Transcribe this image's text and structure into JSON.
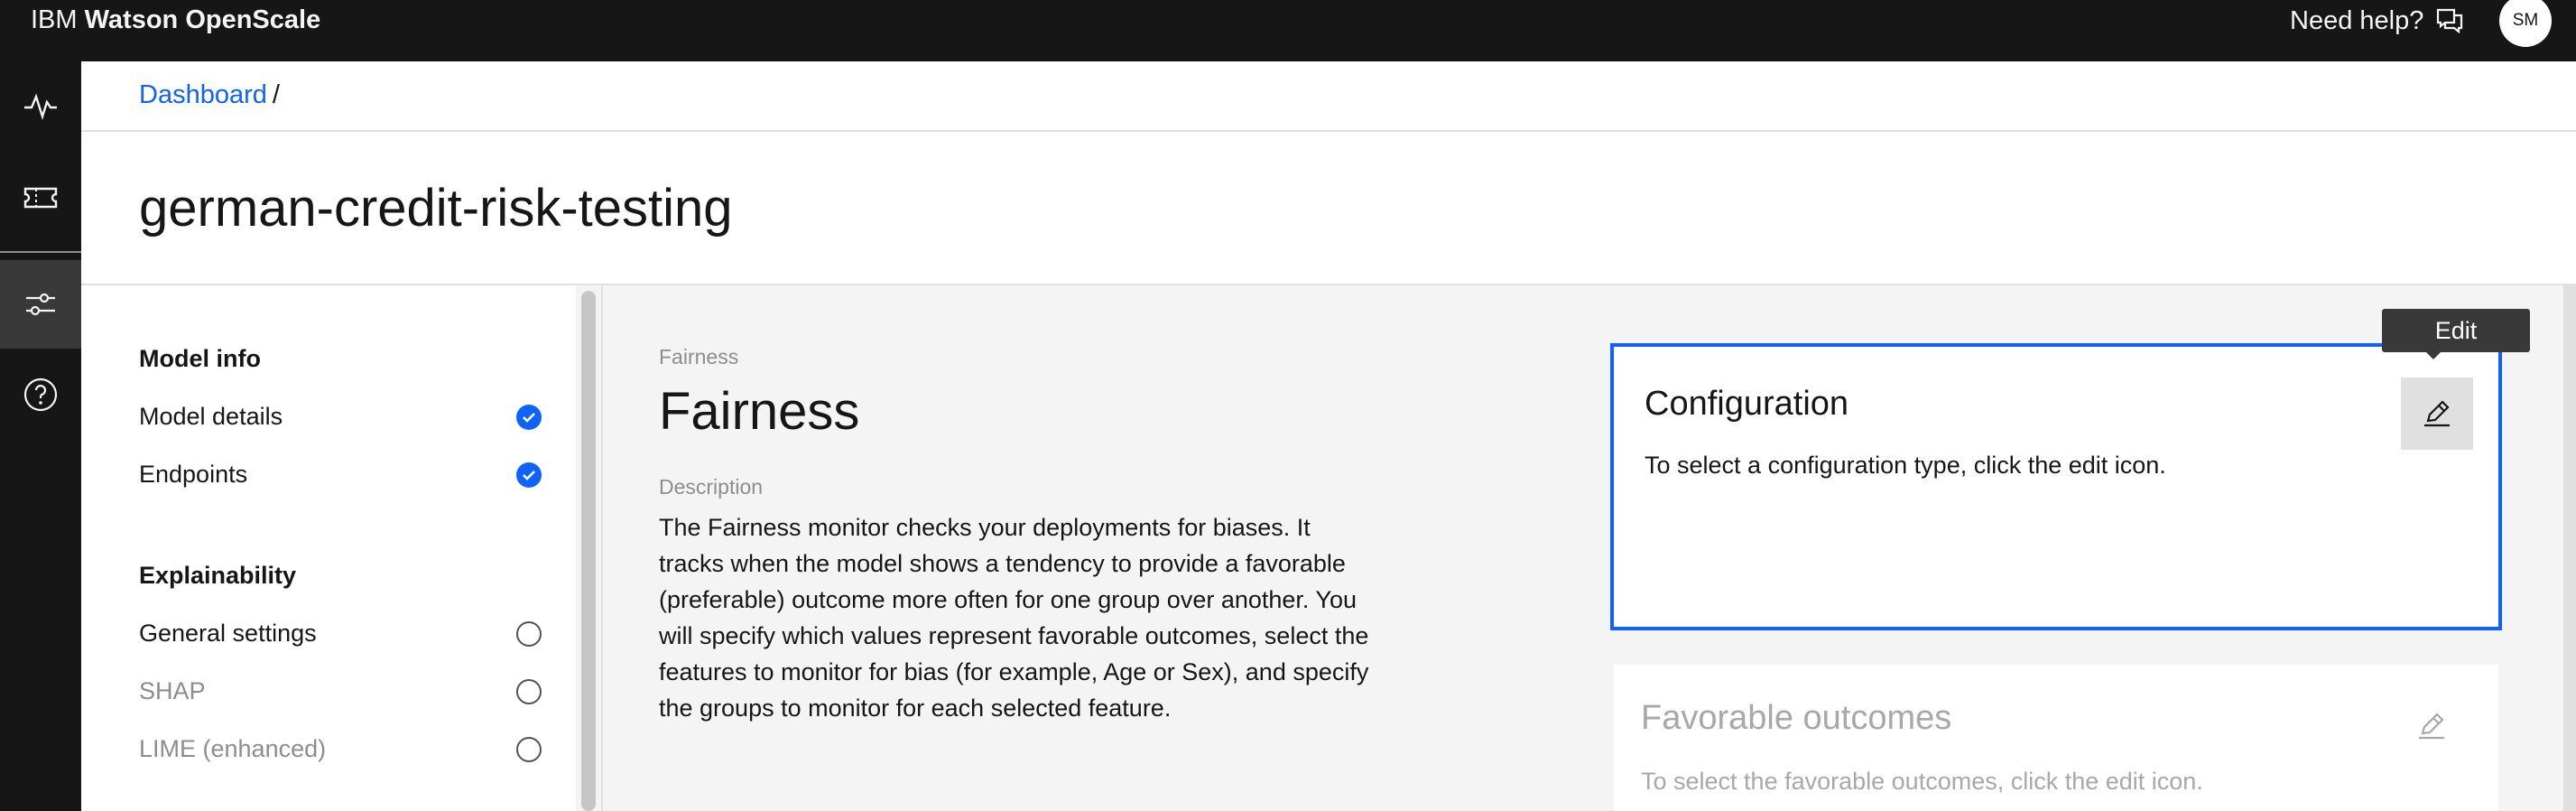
{
  "app": {
    "brand_prefix": "IBM",
    "brand_name": "Watson OpenScale",
    "help_label": "Need help?",
    "avatar_initials": "SM"
  },
  "rail": {
    "items": [
      {
        "icon": "activity-icon"
      },
      {
        "icon": "ticket-icon"
      },
      {
        "icon": "sliders-icon",
        "active": true
      },
      {
        "icon": "help-icon"
      }
    ]
  },
  "breadcrumb": {
    "link": "Dashboard",
    "separator": "/"
  },
  "page": {
    "title": "german-credit-risk-testing"
  },
  "leftnav": {
    "model_info_heading": "Model info",
    "model_details": "Model details",
    "endpoints": "Endpoints",
    "explainability_heading": "Explainability",
    "general_settings": "General settings",
    "shap": "SHAP",
    "lime": "LIME (enhanced)"
  },
  "main": {
    "eyebrow": "Fairness",
    "title": "Fairness",
    "description_label": "Description",
    "description": "The Fairness monitor checks your deployments for biases. It tracks when the model shows a tendency to provide a favorable (preferable) outcome more often for one group over another. You will specify which values represent favorable outcomes, select the features to monitor for bias (for example, Age or Sex), and specify the groups to monitor for each selected feature."
  },
  "config_tile": {
    "title": "Configuration",
    "text": "To select a configuration type, click the edit icon.",
    "tooltip": "Edit"
  },
  "favorable_tile": {
    "title": "Favorable outcomes",
    "text": "To select the favorable outcomes, click the edit icon."
  },
  "colors": {
    "accent": "#0f62fe",
    "topbar": "#161616",
    "main_bg": "#f4f4f4"
  }
}
